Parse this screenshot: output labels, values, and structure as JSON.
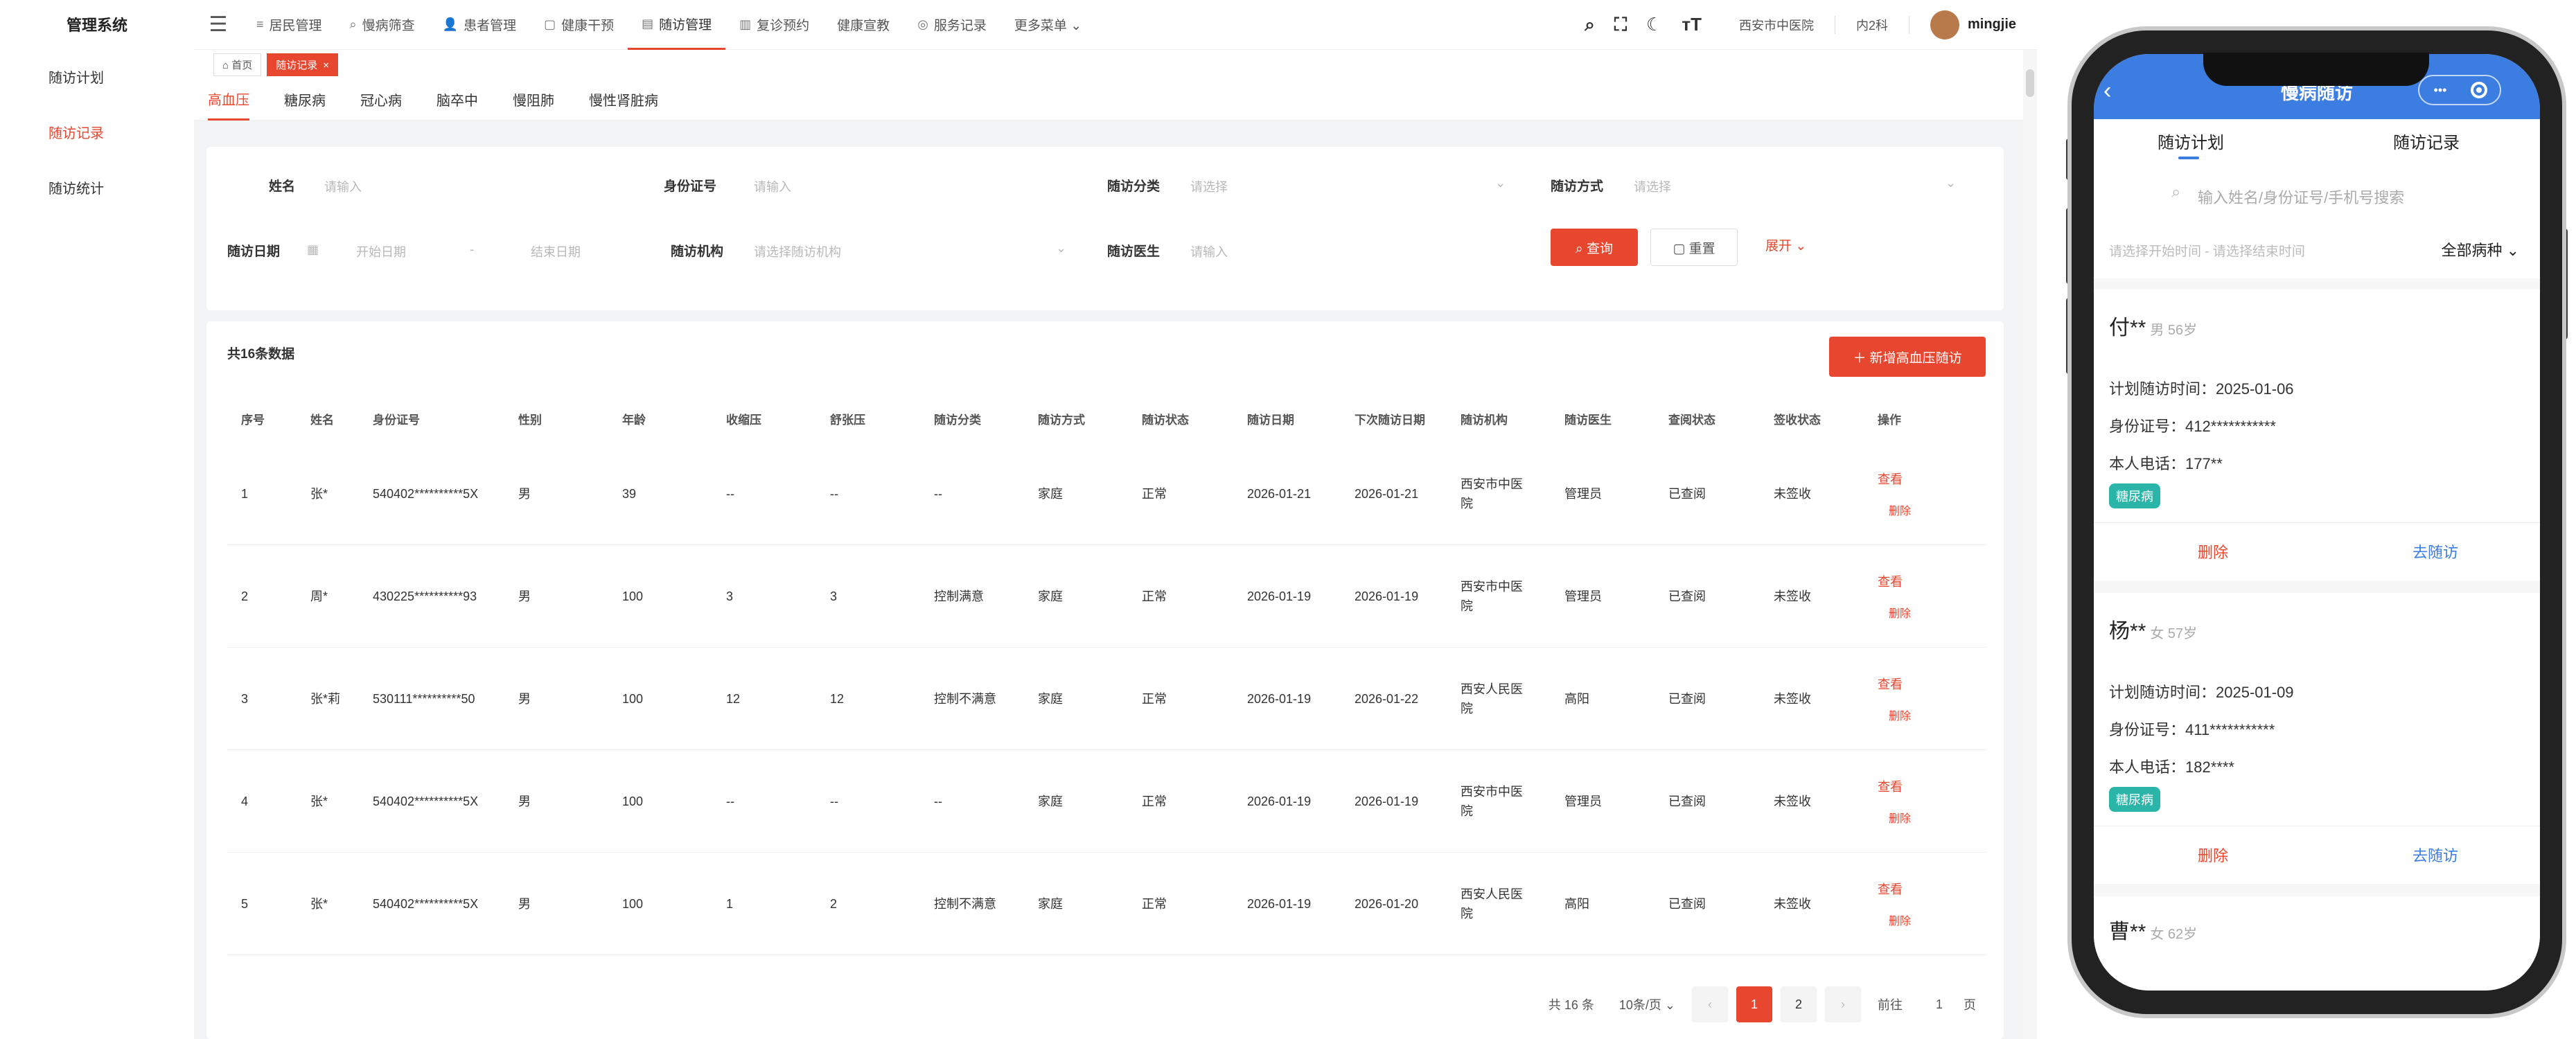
{
  "sidebar": {
    "brand": "管理系统",
    "items": [
      {
        "label": "随访计划",
        "active": false
      },
      {
        "label": "随访记录",
        "active": true
      },
      {
        "label": "随访统计",
        "active": false
      }
    ]
  },
  "header": {
    "hamburger_icon": "menu-icon",
    "nav": [
      {
        "icon": "≡",
        "label": "居民管理",
        "active": false
      },
      {
        "icon": "⌕",
        "label": "慢病筛查",
        "active": false
      },
      {
        "icon": "👤",
        "label": "患者管理",
        "active": false
      },
      {
        "icon": "▢",
        "label": "健康干预",
        "active": false
      },
      {
        "icon": "▤",
        "label": "随访管理",
        "active": true
      },
      {
        "icon": "▥",
        "label": "复诊预约",
        "active": false
      },
      {
        "icon": "",
        "label": "健康宣教",
        "active": false
      },
      {
        "icon": "◎",
        "label": "服务记录",
        "active": false
      },
      {
        "icon": "",
        "label": "更多菜单 ⌄",
        "active": false
      }
    ],
    "tools": [
      "⌕",
      "⛶",
      "☾",
      "ᴛT"
    ],
    "org": "西安市中医院",
    "dept": "内2科",
    "user": "mingjie"
  },
  "breadcrumb_tabs": [
    {
      "label": "⌂ 首页",
      "active": false
    },
    {
      "label": "随访记录",
      "close": "×",
      "active": true
    }
  ],
  "disease_tabs": [
    {
      "label": "高血压",
      "active": true
    },
    {
      "label": "糖尿病",
      "active": false
    },
    {
      "label": "冠心病",
      "active": false
    },
    {
      "label": "脑卒中",
      "active": false
    },
    {
      "label": "慢阻肺",
      "active": false
    },
    {
      "label": "慢性肾脏病",
      "active": false
    }
  ],
  "search": {
    "name_label": "姓名",
    "name_ph": "请输入",
    "id_label": "身份证号",
    "id_ph": "请输入",
    "type_label": "随访分类",
    "type_ph": "请选择",
    "way_label": "随访方式",
    "way_ph": "请选择",
    "date_label": "随访日期",
    "start_ph": "开始日期",
    "range_sep": "-",
    "end_ph": "结束日期",
    "org_label": "随访机构",
    "org_ph": "请选择随访机构",
    "doctor_label": "随访医生",
    "doctor_ph": "请输入",
    "query_btn": "⌕ 查询",
    "reset_btn": "▢ 重置",
    "expand_btn": "展开 ⌄"
  },
  "table": {
    "total": "共16条数据",
    "add_btn": "＋ 新增高血压随访",
    "columns": [
      "序号",
      "姓名",
      "身份证号",
      "性别",
      "年龄",
      "收缩压",
      "舒张压",
      "随访分类",
      "随访方式",
      "随访状态",
      "随访日期",
      "下次随访日期",
      "随访机构",
      "随访医生",
      "查阅状态",
      "签收状态",
      "操作"
    ],
    "view_label": "查看",
    "delete_label": "删除",
    "rows": [
      {
        "no": "1",
        "name": "张*",
        "id": "540402**********5X",
        "sex": "男",
        "age": "39",
        "sbp": "--",
        "dbp": "--",
        "type": "--",
        "way": "家庭",
        "status": "正常",
        "date": "2026-01-21",
        "next": "2026-01-21",
        "org": "西安市中医院",
        "doctor": "管理员",
        "read": "已查阅",
        "sign": "未签收"
      },
      {
        "no": "2",
        "name": "周*",
        "id": "430225**********93",
        "sex": "男",
        "age": "100",
        "sbp": "3",
        "dbp": "3",
        "type": "控制满意",
        "way": "家庭",
        "status": "正常",
        "date": "2026-01-19",
        "next": "2026-01-19",
        "org": "西安市中医院",
        "doctor": "管理员",
        "read": "已查阅",
        "sign": "未签收"
      },
      {
        "no": "3",
        "name": "张*莉",
        "id": "530111**********50",
        "sex": "男",
        "age": "100",
        "sbp": "12",
        "dbp": "12",
        "type": "控制不满意",
        "way": "家庭",
        "status": "正常",
        "date": "2026-01-19",
        "next": "2026-01-22",
        "org": "西安人民医院",
        "doctor": "高阳",
        "read": "已查阅",
        "sign": "未签收"
      },
      {
        "no": "4",
        "name": "张*",
        "id": "540402**********5X",
        "sex": "男",
        "age": "100",
        "sbp": "--",
        "dbp": "--",
        "type": "--",
        "way": "家庭",
        "status": "正常",
        "date": "2026-01-19",
        "next": "2026-01-19",
        "org": "西安市中医院",
        "doctor": "管理员",
        "read": "已查阅",
        "sign": "未签收"
      },
      {
        "no": "5",
        "name": "张*",
        "id": "540402**********5X",
        "sex": "男",
        "age": "100",
        "sbp": "1",
        "dbp": "2",
        "type": "控制不满意",
        "way": "家庭",
        "status": "正常",
        "date": "2026-01-19",
        "next": "2026-01-20",
        "org": "西安人民医院",
        "doctor": "高阳",
        "read": "已查阅",
        "sign": "未签收"
      }
    ]
  },
  "pagination": {
    "total": "共 16 条",
    "page_size": "10条/页",
    "pages": [
      "1",
      "2"
    ],
    "current": "1",
    "goto_label": "前往",
    "goto_value": "1",
    "page_unit": "页"
  },
  "chat_fab": "••",
  "mobile": {
    "title": "慢病随访",
    "caps_dots": "•••",
    "tabs": [
      "随访计划",
      "随访记录"
    ],
    "search_ph": "输入姓名/身份证号/手机号搜索",
    "date_ph": "请选择开始时间 - 请选择结束时间",
    "disease_dd": "全部病种 ⌄",
    "cards": [
      {
        "name": "付**",
        "sub": "男 56岁",
        "plan": "计划随访时间：2025-01-06",
        "id": "身份证号：412***********",
        "phone": "本人电话：177**",
        "tag": "糖尿病",
        "del": "删除",
        "go": "去随访"
      },
      {
        "name": "杨**",
        "sub": "女 57岁",
        "plan": "计划随访时间：2025-01-09",
        "id": "身份证号：411***********",
        "phone": "本人电话：182****",
        "tag": "糖尿病",
        "del": "删除",
        "go": "去随访"
      },
      {
        "name": "曹**",
        "sub": "女 62岁"
      }
    ]
  }
}
